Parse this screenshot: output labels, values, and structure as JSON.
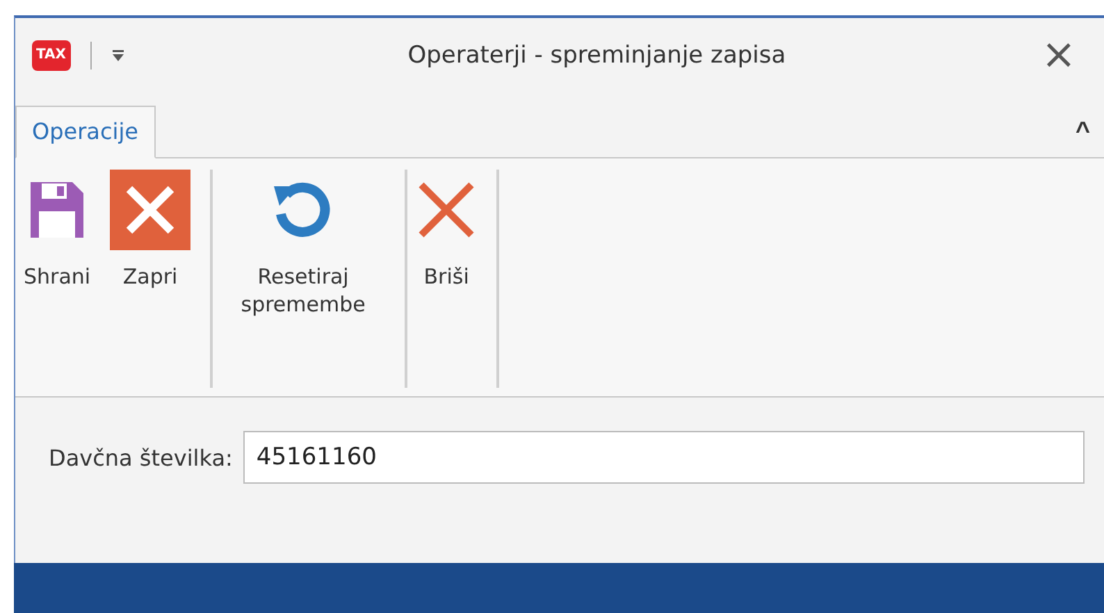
{
  "window": {
    "app_badge": "TAX",
    "title": "Operaterji - spreminjanje zapisa",
    "close": "×"
  },
  "tabs": [
    {
      "label": "Operacije",
      "selected": true
    }
  ],
  "ribbon": {
    "collapse": "^",
    "groups": [
      {
        "buttons": [
          {
            "kind": "save",
            "label": "Shrani"
          },
          {
            "kind": "close",
            "label": "Zapri"
          }
        ]
      },
      {
        "buttons": [
          {
            "kind": "reset",
            "label": "Resetiraj spremembe"
          }
        ]
      },
      {
        "buttons": [
          {
            "kind": "delete",
            "label": "Briši"
          }
        ]
      }
    ]
  },
  "form": {
    "fields": [
      {
        "label": "Davčna številka:",
        "value": "45161160"
      }
    ]
  }
}
